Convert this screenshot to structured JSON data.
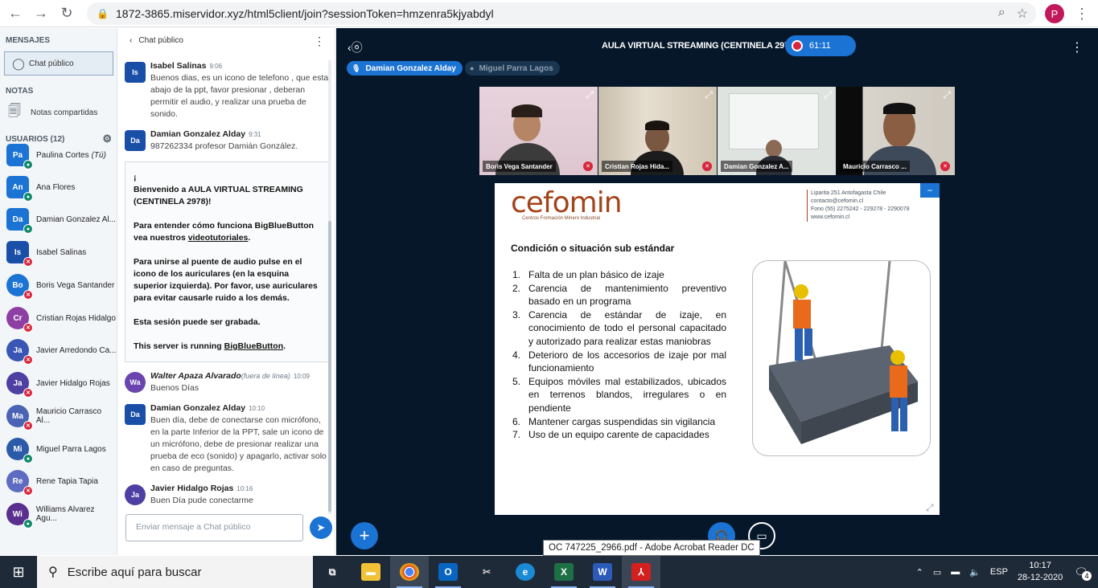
{
  "browser": {
    "url": "1872-3865.miservidor.xyz/html5client/join?sessionToken=hmzenra5kjyabdyl",
    "profile_initial": "P"
  },
  "sidebar": {
    "messages_title": "MENSAJES",
    "public_chat_label": "Chat público",
    "notes_title": "NOTAS",
    "shared_notes_label": "Notas compartidas",
    "users_title": "USUARIOS (12)",
    "users": [
      {
        "initials": "Pa",
        "name": "Paulina Cortes",
        "suffix": "(Tú)",
        "color": "#1b73d3",
        "mic": "on",
        "shape": "square"
      },
      {
        "initials": "An",
        "name": "Ana Flores",
        "suffix": "",
        "color": "#1b73d3",
        "mic": "on",
        "shape": "square"
      },
      {
        "initials": "Da",
        "name": "Damian Gonzalez Al...",
        "suffix": "",
        "color": "#1b73d3",
        "mic": "on",
        "shape": "square"
      },
      {
        "initials": "Is",
        "name": "Isabel Salinas",
        "suffix": "",
        "color": "#1a4fa8",
        "mic": "off",
        "shape": "square"
      },
      {
        "initials": "Bo",
        "name": "Boris Vega Santander",
        "suffix": "",
        "color": "#1b73d3",
        "mic": "off",
        "shape": "round"
      },
      {
        "initials": "Cr",
        "name": "Cristian Rojas Hidalgo",
        "suffix": "",
        "color": "#8e3fa3",
        "mic": "off",
        "shape": "round"
      },
      {
        "initials": "Ja",
        "name": "Javier Arredondo Ca...",
        "suffix": "",
        "color": "#3a56b5",
        "mic": "off",
        "shape": "round"
      },
      {
        "initials": "Ja",
        "name": "Javier Hidalgo Rojas",
        "suffix": "",
        "color": "#4e3fa3",
        "mic": "off",
        "shape": "round"
      },
      {
        "initials": "Ma",
        "name": "Mauricio Carrasco Al...",
        "suffix": "",
        "color": "#4b63b5",
        "mic": "off",
        "shape": "round"
      },
      {
        "initials": "Mi",
        "name": "Miguel Parra Lagos",
        "suffix": "",
        "color": "#2a5aa8",
        "mic": "on",
        "shape": "round"
      },
      {
        "initials": "Re",
        "name": "Rene Tapia Tapia",
        "suffix": "",
        "color": "#5d6cc0",
        "mic": "off",
        "shape": "round"
      },
      {
        "initials": "Wi",
        "name": "Williams Alvarez Agu...",
        "suffix": "",
        "color": "#5a2f8e",
        "mic": "on",
        "shape": "round"
      }
    ]
  },
  "chat": {
    "title": "Chat público",
    "messages": [
      {
        "initials": "Is",
        "color": "#1a4fa8",
        "name": "Isabel Salinas",
        "time": "9:06",
        "text": "Buenos dias, es un icono de telefono , que esta abajo de la ppt, favor presionar , deberan permitir el audio, y realizar una prueba de sonido."
      },
      {
        "initials": "Da",
        "color": "#1a4fa8",
        "name": "Damian Gonzalez Alday",
        "time": "9:31",
        "text": "987262334 profesor Damián González."
      },
      {
        "initials": "Wa",
        "color": "#6a45b0",
        "name": "Walter Apaza Alvarado",
        "offline": "(fuera de línea)",
        "time": "10:09",
        "text": "Buenos Días"
      },
      {
        "initials": "Da",
        "color": "#1a4fa8",
        "name": "Damian Gonzalez Alday",
        "time": "10:10",
        "text": "Buen día, debe de conectarse con micrófono, en la parte Inferior de la PPT, sale un icono de un micrófono, debe de presionar realizar una prueba de eco (sonido) y apagarlo, activar solo en caso de preguntas."
      },
      {
        "initials": "Ja",
        "color": "#4e3fa3",
        "name": "Javier Hidalgo Rojas",
        "time": "10:16",
        "text": "Buen Día pude conectarme"
      }
    ],
    "welcome": {
      "line1": "¡",
      "line2a": "Bienvenido a ",
      "line2b": "AULA VIRTUAL STREAMING (CENTINELA 2978)",
      "line2c": "!",
      "p2a": "Para entender cómo funciona BigBlueButton vea nuestros ",
      "p2link": "videotutoriales",
      "p2b": ".",
      "p3": "Para unirse al puente de audio pulse en el icono de los auriculares (en la esquina superior izquierda). Por favor, use auriculares para evitar causarle ruido a los demás.",
      "p4": "Esta sesión puede ser grabada.",
      "p5a": "This server is running ",
      "p5link": "BigBlueButton",
      "p5b": "."
    },
    "input_placeholder": "Enviar mensaje a Chat público"
  },
  "main": {
    "room_title": "AULA VIRTUAL STREAMING (CENTINELA 2978)",
    "recording_time": "61:11",
    "talkers": [
      "Damian Gonzalez Alday",
      "Miguel Parra Lagos"
    ],
    "videos": [
      {
        "label": "Boris Vega Santander"
      },
      {
        "label": "Cristian Rojas Hida..."
      },
      {
        "label": "Damian Gonzalez A..."
      },
      {
        "label": "Mauricio Carrasco ..."
      }
    ],
    "tooltip": "OC 747225_2966.pdf - Adobe Acrobat Reader DC"
  },
  "slide": {
    "logo": "cefomin",
    "logo_sub": "Centros Formación Minero Industrial",
    "contact": [
      "Liparita 251 Antofagasta Chile",
      "contacto@cefomin.cl",
      "Fono (55) 2275242 - 229278 - 2290078",
      "www.cefomin.cl"
    ],
    "title": "Condición o situación sub estándar",
    "items": [
      "Falta de un plan básico de izaje",
      "Carencia de mantenimiento preventivo basado en un programa",
      "Carencia de estándar de izaje, en conocimiento de todo el personal capacitado y autorizado para realizar estas maniobras",
      "Deterioro de los accesorios de izaje por mal funcionamiento",
      "Equipos móviles mal estabilizados, ubicados en terrenos blandos, irregulares o en pendiente",
      "Mantener cargas suspendidas sin vigilancia",
      "Uso de un equipo carente de capacidades"
    ]
  },
  "taskbar": {
    "search_placeholder": "Escribe aquí para buscar",
    "language": "ESP",
    "time": "10:17",
    "date": "28-12-2020",
    "notifications": "4"
  }
}
